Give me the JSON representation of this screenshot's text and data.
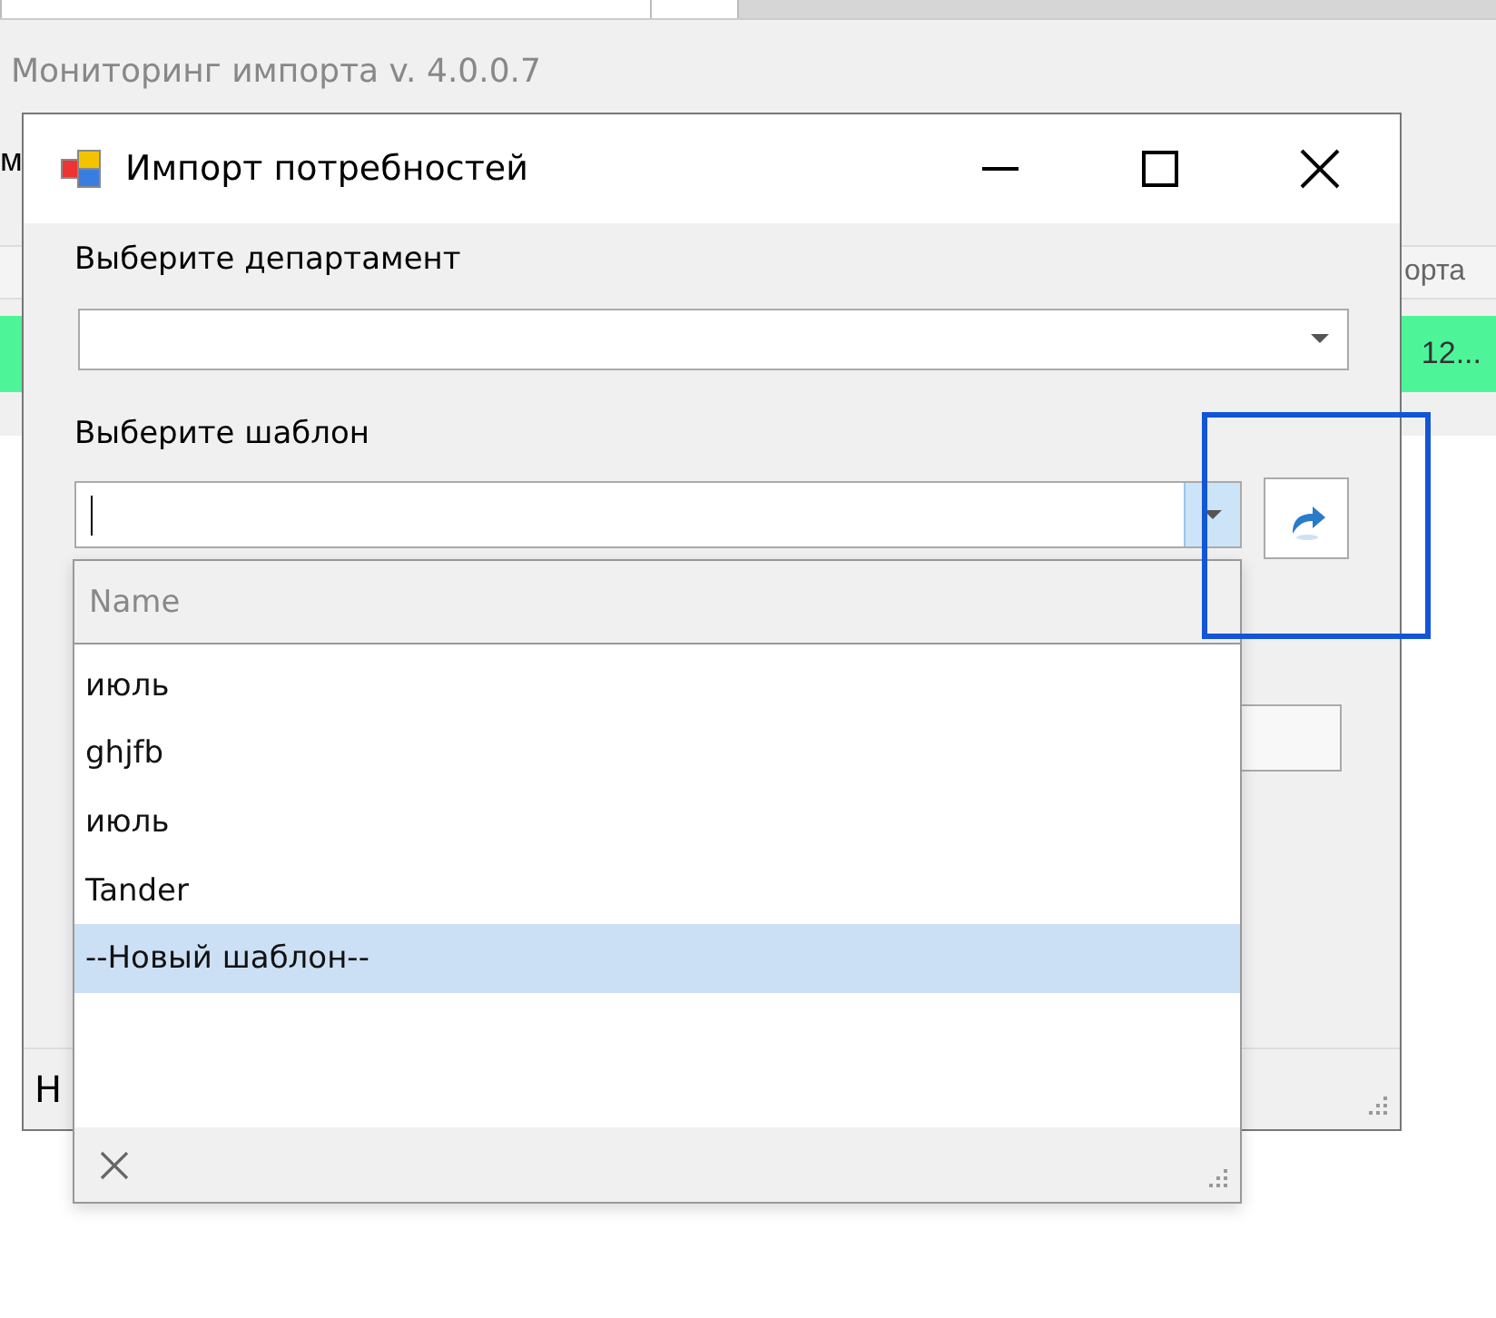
{
  "background": {
    "title": "Мониторинг импорта v. 4.0.0.7",
    "label_fragment": "м",
    "table": {
      "header": [
        "орта"
      ],
      "row": [
        "12..."
      ]
    }
  },
  "dialog": {
    "title": "Импорт потребностей",
    "department": {
      "label": "Выберите департамент"
    },
    "template": {
      "label": "Выберите шаблон",
      "dropdown_open": true
    },
    "status_text": "Н"
  },
  "popup": {
    "column": "Name",
    "items": [
      {
        "text": "июль",
        "selected": false
      },
      {
        "text": "ghjfb",
        "selected": false
      },
      {
        "text": "июль",
        "selected": false
      },
      {
        "text": "Tander",
        "selected": false
      },
      {
        "text": "--Новый шаблон--",
        "selected": true
      }
    ]
  }
}
